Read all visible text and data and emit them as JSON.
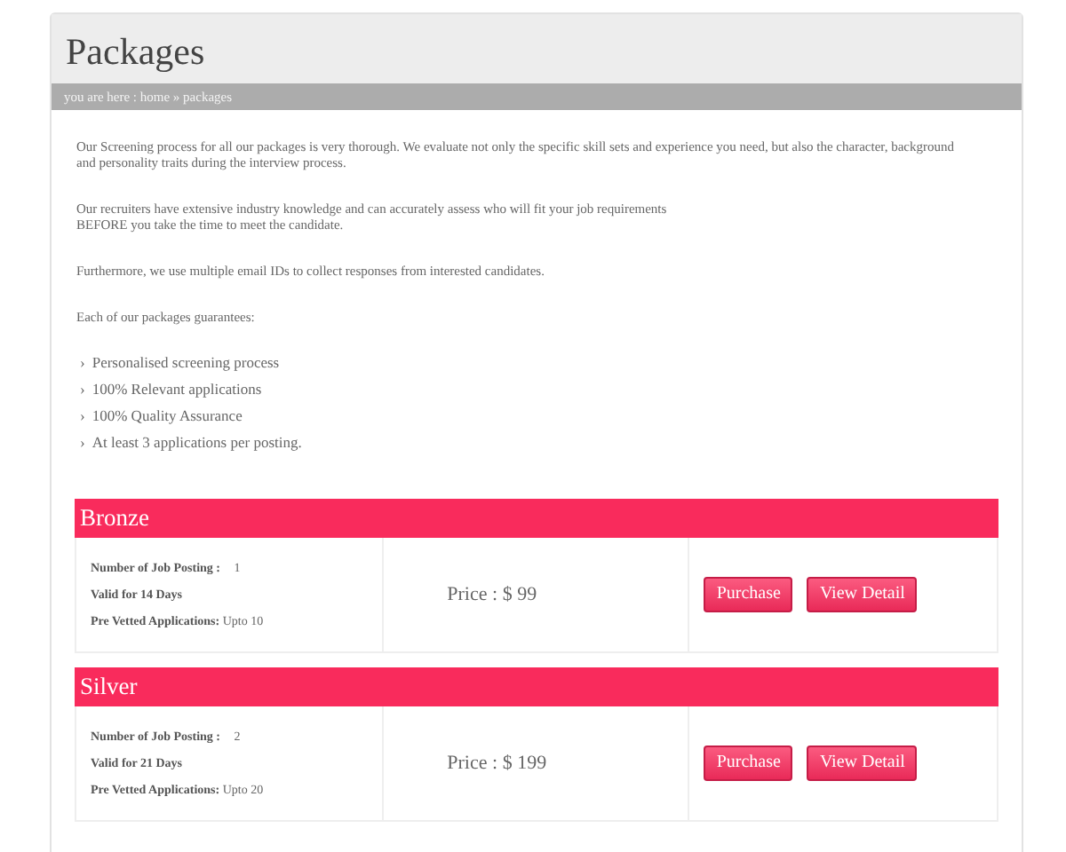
{
  "title": "Packages",
  "breadcrumb": "you are here : home » packages",
  "paragraphs": [
    "Our Screening process for all our packages is very thorough. We evaluate not only the specific skill sets and experience you need, but also the character, background\nand personality traits during the interview process.",
    "Our recruiters have extensive industry knowledge and can accurately assess who will fit your job requirements\n BEFORE you take the time to meet the candidate.",
    "Furthermore, we use multiple email IDs to collect responses from interested candidates.",
    "Each of our packages guarantees:"
  ],
  "guarantees": [
    "Personalised screening process",
    "100% Relevant applications",
    "100% Quality Assurance",
    "At least 3 applications per posting."
  ],
  "bullet": "›",
  "packages": [
    {
      "name": "Bronze",
      "postings_label": "Number of Job Posting :",
      "postings": "1",
      "validity": "Valid for 14 Days",
      "vetted_label": "Pre Vetted Applications:",
      "vetted": "Upto 10",
      "price": "Price : $ 99",
      "buttons": [
        "Purchase",
        "View Detail"
      ]
    },
    {
      "name": "Silver",
      "postings_label": "Number of Job Posting :",
      "postings": "2",
      "validity": "Valid for 21 Days",
      "vetted_label": "Pre Vetted Applications:",
      "vetted": "Upto 20",
      "price": "Price : $ 199",
      "buttons": [
        "Purchase",
        "View Detail"
      ]
    }
  ]
}
